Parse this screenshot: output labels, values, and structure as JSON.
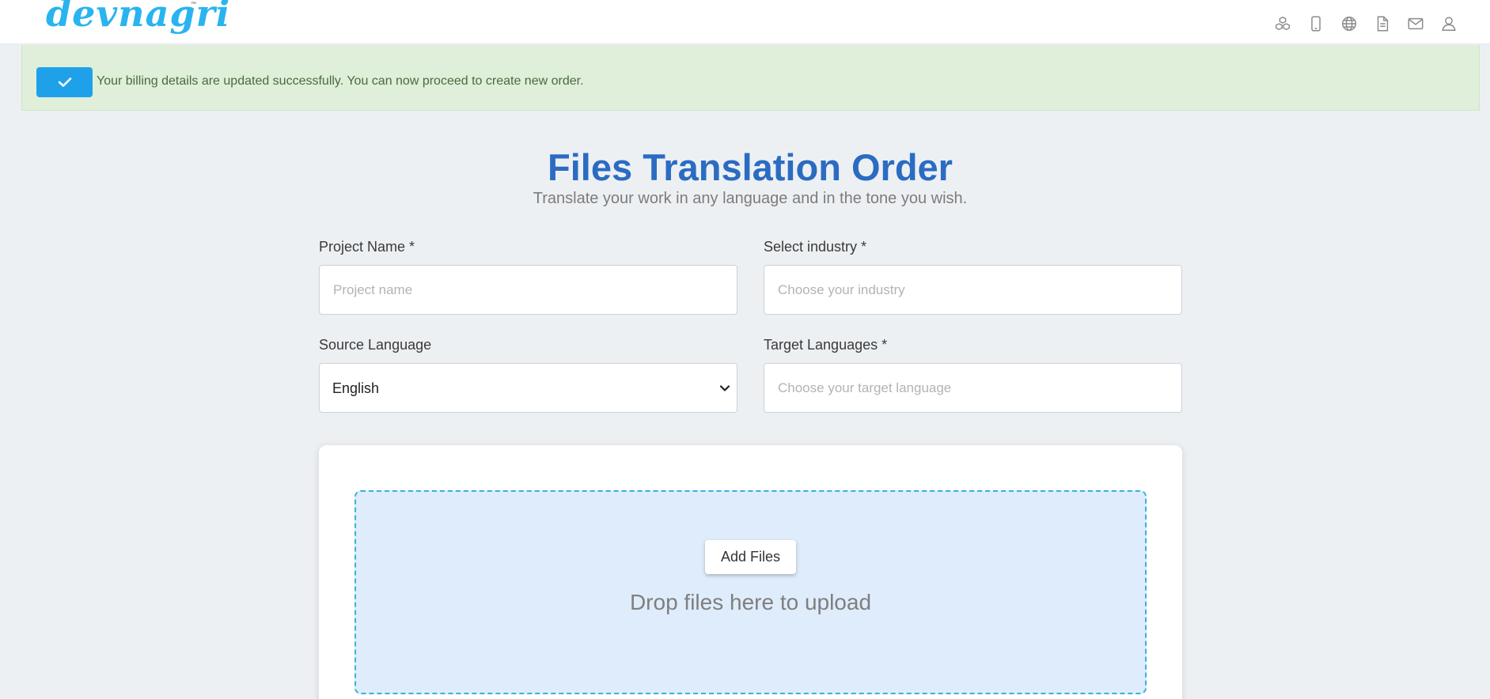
{
  "header": {
    "logo_text": "devnagri",
    "logo_tm": "™",
    "nav_icons": [
      "cubes-icon",
      "mobile-icon",
      "globe-icon",
      "document-icon",
      "mail-icon",
      "user-icon"
    ]
  },
  "alert": {
    "message": "Your billing details are updated successfully. You can now proceed to create new order.",
    "accent_color": "#1fa1ea",
    "background_color": "#dfefda"
  },
  "page": {
    "title": "Files Translation Order",
    "subtitle": "Translate your work in any language and in the tone you wish.",
    "title_color": "#2b6cc2"
  },
  "form": {
    "project_name": {
      "label": "Project Name *",
      "placeholder": "Project name",
      "value": ""
    },
    "industry": {
      "label": "Select industry *",
      "placeholder": "Choose your industry",
      "value": ""
    },
    "source_language": {
      "label": "Source Language",
      "value": "English"
    },
    "target_languages": {
      "label": "Target Languages *",
      "placeholder": "Choose your target language",
      "value": ""
    }
  },
  "upload": {
    "add_files_label": "Add Files",
    "drop_text": "Drop files here to upload"
  }
}
